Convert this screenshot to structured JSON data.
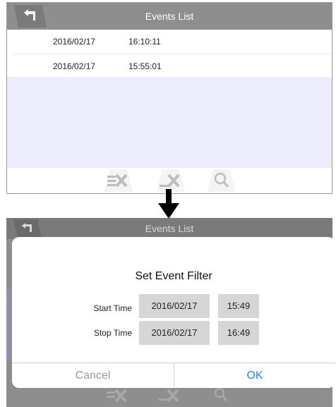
{
  "top_screen": {
    "title": "Events List",
    "events": [
      {
        "date": "2016/02/17",
        "time": "16:10:11"
      },
      {
        "date": "2016/02/17",
        "time": "15:55:01"
      }
    ],
    "toolbar": [
      "delete-selected-icon",
      "delete-all-icon",
      "search-icon"
    ]
  },
  "bottom_screen": {
    "title": "Events List"
  },
  "dialog": {
    "title": "Set Event Filter",
    "start": {
      "label": "Start Time",
      "date": "2016/02/17",
      "time": "15:49"
    },
    "stop": {
      "label": "Stop Time",
      "date": "2016/02/17",
      "time": "16:49"
    },
    "cancel_label": "Cancel",
    "ok_label": "OK"
  },
  "colors": {
    "header": "#8e8e8e",
    "highlight_row": "#ececfd",
    "ok": "#1e88e5"
  }
}
